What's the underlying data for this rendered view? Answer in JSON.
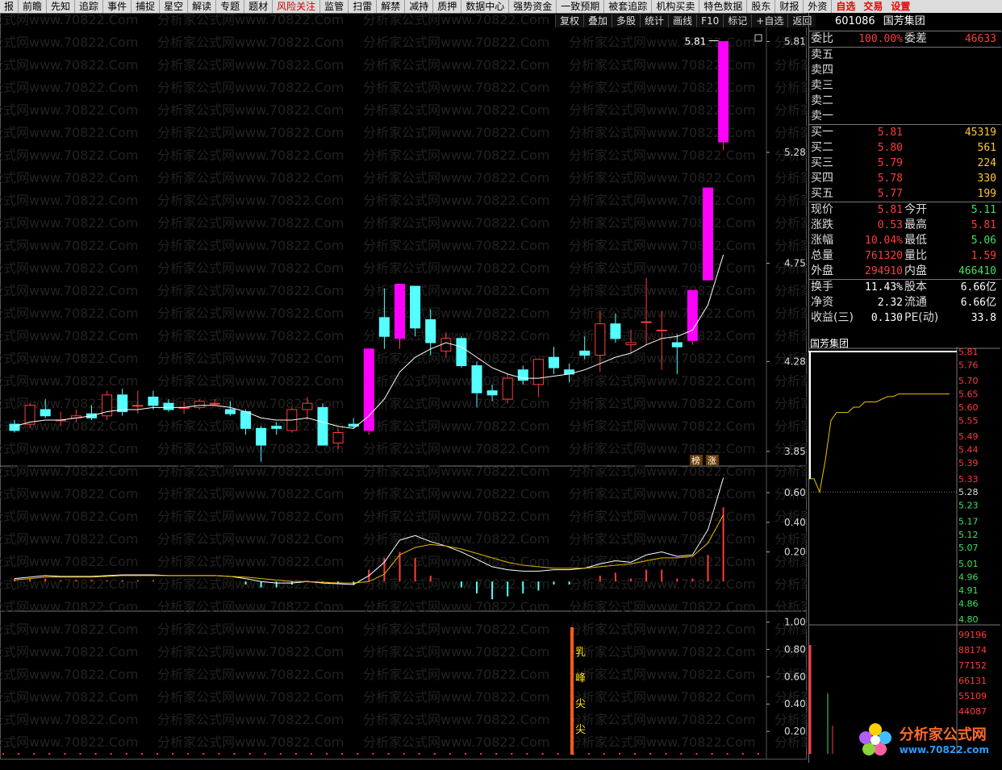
{
  "menu": [
    "报",
    "前瞻",
    "先知",
    "追踪",
    "事件",
    "捕捉",
    "星空",
    "解读",
    "专题",
    "题材",
    "风险关注",
    "监管",
    "扫雷",
    "解禁",
    "减持",
    "质押",
    "数据中心",
    "强势资金",
    "一致预期",
    "被套追踪",
    "机构买卖",
    "特色数据",
    "股东",
    "财报",
    "外资",
    "自选",
    "交易",
    "设置"
  ],
  "toolbar": [
    "复权",
    "叠加",
    "多股",
    "统计",
    "画线",
    "F10",
    "标记",
    "+自选",
    "返回"
  ],
  "symbol": {
    "code": "601086",
    "name": "国芳集团"
  },
  "weibi": {
    "label": "委比",
    "value": "100.00%",
    "label2": "委差",
    "value2": "46633"
  },
  "asks": [
    "卖五",
    "卖四",
    "卖三",
    "卖二",
    "卖一"
  ],
  "bids": [
    {
      "label": "买一",
      "price": "5.81",
      "vol": "45319"
    },
    {
      "label": "买二",
      "price": "5.80",
      "vol": "561"
    },
    {
      "label": "买三",
      "price": "5.79",
      "vol": "224"
    },
    {
      "label": "买四",
      "price": "5.78",
      "vol": "330"
    },
    {
      "label": "买五",
      "price": "5.77",
      "vol": "199"
    }
  ],
  "quote": [
    {
      "l1": "现价",
      "v1": "5.81",
      "l2": "今开",
      "v2": "5.11",
      "c2": "#3fe060"
    },
    {
      "l1": "涨跌",
      "v1": "0.53",
      "l2": "最高",
      "v2": "5.81",
      "c2": "#ff3b3b"
    },
    {
      "l1": "涨幅",
      "v1": "10.04%",
      "l2": "最低",
      "v2": "5.06",
      "c2": "#3fe060"
    },
    {
      "l1": "总量",
      "v1": "761320",
      "l2": "量比",
      "v2": "1.59",
      "c2": "#ff3b3b"
    },
    {
      "l1": "外盘",
      "v1": "294910",
      "l2": "内盘",
      "v2": "466410",
      "c2": "#3fe060"
    }
  ],
  "fund": [
    {
      "l1": "换手",
      "v1": "11.43%",
      "l2": "股本",
      "v2": "6.66亿"
    },
    {
      "l1": "净资",
      "v1": "2.32",
      "l2": "流通",
      "v2": "6.66亿"
    },
    {
      "l1": "收益(三)",
      "v1": "0.130",
      "l2": "PE(动)",
      "v2": "33.8"
    }
  ],
  "mini_title": "国芳集团",
  "price_ticks": [
    "5.81",
    "5.28",
    "4.75",
    "4.28",
    "3.85"
  ],
  "macd_ticks": [
    "0.60",
    "0.40",
    "0.20"
  ],
  "ind_ticks": [
    "1.00",
    "0.80",
    "0.60",
    "0.40",
    "0.20"
  ],
  "high_label": "5.81",
  "badges": [
    "榜",
    "涨"
  ],
  "signal_text": [
    "乳",
    "峰",
    "尖",
    "尖"
  ],
  "mini_price_ticks": [
    "5.81",
    "5.76",
    "5.70",
    "5.65",
    "5.60",
    "5.55",
    "5.49",
    "5.44",
    "5.39",
    "5.33",
    "5.28",
    "5.23",
    "5.17",
    "5.12",
    "5.07",
    "5.01",
    "4.96",
    "4.91",
    "4.86",
    "4.80"
  ],
  "mini_vol_ticks": [
    "99196",
    "88174",
    "77152",
    "66131",
    "55109",
    "44087"
  ],
  "watermark": {
    "brand": "分析家公式网",
    "url": "www.70822.com"
  },
  "bg_watermark": "分析家公式网www.70822.Com",
  "chart_data": {
    "type": "candlestick",
    "candles": [
      {
        "o": 3.98,
        "h": 4.0,
        "l": 3.94,
        "c": 3.95
      },
      {
        "o": 3.98,
        "h": 4.08,
        "l": 3.96,
        "c": 4.07
      },
      {
        "o": 4.05,
        "h": 4.1,
        "l": 4.01,
        "c": 4.02
      },
      {
        "o": 4.0,
        "h": 4.04,
        "l": 3.97,
        "c": 4.0
      },
      {
        "o": 4.01,
        "h": 4.05,
        "l": 3.99,
        "c": 4.02
      },
      {
        "o": 4.03,
        "h": 4.07,
        "l": 4.0,
        "c": 4.01
      },
      {
        "o": 4.02,
        "h": 4.14,
        "l": 4.0,
        "c": 4.12
      },
      {
        "o": 4.12,
        "h": 4.15,
        "l": 4.02,
        "c": 4.04
      },
      {
        "o": 4.07,
        "h": 4.14,
        "l": 4.03,
        "c": 4.07
      },
      {
        "o": 4.11,
        "h": 4.14,
        "l": 4.05,
        "c": 4.07
      },
      {
        "o": 4.08,
        "h": 4.1,
        "l": 4.04,
        "c": 4.05
      },
      {
        "o": 4.06,
        "h": 4.09,
        "l": 4.03,
        "c": 4.06
      },
      {
        "o": 4.06,
        "h": 4.1,
        "l": 4.05,
        "c": 4.09
      },
      {
        "o": 4.08,
        "h": 4.1,
        "l": 4.07,
        "c": 4.08
      },
      {
        "o": 4.05,
        "h": 4.09,
        "l": 4.02,
        "c": 4.03
      },
      {
        "o": 4.04,
        "h": 4.05,
        "l": 3.93,
        "c": 3.96
      },
      {
        "o": 3.96,
        "h": 3.97,
        "l": 3.8,
        "c": 3.88
      },
      {
        "o": 3.97,
        "h": 3.99,
        "l": 3.93,
        "c": 3.96
      },
      {
        "o": 3.95,
        "h": 4.06,
        "l": 3.94,
        "c": 4.05
      },
      {
        "o": 4.05,
        "h": 4.11,
        "l": 4.0,
        "c": 4.08
      },
      {
        "o": 4.06,
        "h": 4.08,
        "l": 3.88,
        "c": 3.88
      },
      {
        "o": 3.89,
        "h": 3.96,
        "l": 3.86,
        "c": 3.94
      },
      {
        "o": 3.98,
        "h": 4.01,
        "l": 3.96,
        "c": 3.97
      },
      {
        "o": 3.95,
        "h": 4.34,
        "l": 3.93,
        "c": 4.34
      },
      {
        "o": 4.49,
        "h": 4.63,
        "l": 4.34,
        "c": 4.4
      },
      {
        "o": 4.39,
        "h": 4.65,
        "l": 4.34,
        "c": 4.65
      },
      {
        "o": 4.64,
        "h": 4.64,
        "l": 4.4,
        "c": 4.44
      },
      {
        "o": 4.48,
        "h": 4.53,
        "l": 4.31,
        "c": 4.37
      },
      {
        "o": 4.33,
        "h": 4.42,
        "l": 4.3,
        "c": 4.39
      },
      {
        "o": 4.39,
        "h": 4.4,
        "l": 4.25,
        "c": 4.26
      },
      {
        "o": 4.26,
        "h": 4.28,
        "l": 4.06,
        "c": 4.13
      },
      {
        "o": 4.14,
        "h": 4.17,
        "l": 4.09,
        "c": 4.12
      },
      {
        "o": 4.1,
        "h": 4.22,
        "l": 4.08,
        "c": 4.2
      },
      {
        "o": 4.24,
        "h": 4.26,
        "l": 4.17,
        "c": 4.19
      },
      {
        "o": 4.17,
        "h": 4.29,
        "l": 4.11,
        "c": 4.29
      },
      {
        "o": 4.3,
        "h": 4.35,
        "l": 4.22,
        "c": 4.25
      },
      {
        "o": 4.24,
        "h": 4.27,
        "l": 4.18,
        "c": 4.22
      },
      {
        "o": 4.33,
        "h": 4.4,
        "l": 4.29,
        "c": 4.31
      },
      {
        "o": 4.31,
        "h": 4.52,
        "l": 4.23,
        "c": 4.46
      },
      {
        "o": 4.46,
        "h": 4.51,
        "l": 4.37,
        "c": 4.39
      },
      {
        "o": 4.36,
        "h": 4.43,
        "l": 4.32,
        "c": 4.37
      },
      {
        "o": 4.47,
        "h": 4.68,
        "l": 4.36,
        "c": 4.47
      },
      {
        "o": 4.43,
        "h": 4.52,
        "l": 4.24,
        "c": 4.43
      },
      {
        "o": 4.37,
        "h": 4.41,
        "l": 4.22,
        "c": 4.35
      },
      {
        "o": 4.38,
        "h": 4.62,
        "l": 4.36,
        "c": 4.62
      },
      {
        "o": 4.67,
        "h": 5.11,
        "l": 4.67,
        "c": 5.11
      },
      {
        "o": 5.33,
        "h": 5.81,
        "l": 5.29,
        "c": 5.81
      }
    ],
    "ma": [
      3.97,
      3.99,
      4.0,
      4.0,
      4.01,
      4.02,
      4.04,
      4.05,
      4.05,
      4.06,
      4.06,
      4.06,
      4.07,
      4.07,
      4.06,
      4.04,
      4.01,
      4.0,
      4.0,
      4.01,
      3.99,
      3.97,
      3.96,
      4.02,
      4.1,
      4.23,
      4.3,
      4.34,
      4.37,
      4.35,
      4.3,
      4.25,
      4.22,
      4.2,
      4.2,
      4.21,
      4.22,
      4.24,
      4.27,
      4.3,
      4.32,
      4.36,
      4.39,
      4.4,
      4.43,
      4.55,
      4.79
    ],
    "ylim": [
      3.78,
      5.87
    ],
    "macd_dif": [
      0.02,
      0.03,
      0.04,
      0.035,
      0.035,
      0.035,
      0.04,
      0.045,
      0.045,
      0.045,
      0.04,
      0.04,
      0.04,
      0.04,
      0.035,
      0.02,
      0.0,
      -0.01,
      -0.01,
      0.0,
      -0.01,
      -0.015,
      -0.02,
      0.04,
      0.13,
      0.28,
      0.31,
      0.27,
      0.24,
      0.2,
      0.15,
      0.1,
      0.08,
      0.07,
      0.07,
      0.08,
      0.08,
      0.09,
      0.12,
      0.14,
      0.13,
      0.18,
      0.2,
      0.17,
      0.18,
      0.35,
      0.7
    ],
    "macd_dea": [
      0.01,
      0.02,
      0.03,
      0.03,
      0.03,
      0.03,
      0.035,
      0.04,
      0.04,
      0.04,
      0.04,
      0.04,
      0.04,
      0.04,
      0.035,
      0.03,
      0.02,
      0.01,
      0.0,
      0.0,
      -0.005,
      -0.01,
      -0.01,
      0.0,
      0.05,
      0.18,
      0.23,
      0.25,
      0.24,
      0.22,
      0.19,
      0.16,
      0.13,
      0.11,
      0.1,
      0.09,
      0.09,
      0.09,
      0.1,
      0.11,
      0.12,
      0.14,
      0.16,
      0.16,
      0.17,
      0.26,
      0.45
    ],
    "macd_ylim": [
      -0.2,
      0.78
    ],
    "ind_ylim": [
      0,
      1.08
    ]
  },
  "intraday": {
    "ylim": [
      4.8,
      5.81
    ],
    "price": [
      5.33,
      5.33,
      5.28,
      5.4,
      5.55,
      5.58,
      5.58,
      5.58,
      5.6,
      5.6,
      5.62,
      5.62,
      5.62,
      5.63,
      5.64,
      5.64,
      5.65,
      5.65,
      5.65,
      5.65,
      5.65,
      5.65,
      5.65,
      5.65,
      5.65,
      5.65
    ],
    "high": [
      5.81,
      5.81,
      5.81,
      5.81,
      5.81,
      5.81,
      5.81,
      5.81,
      5.81,
      5.81
    ]
  }
}
